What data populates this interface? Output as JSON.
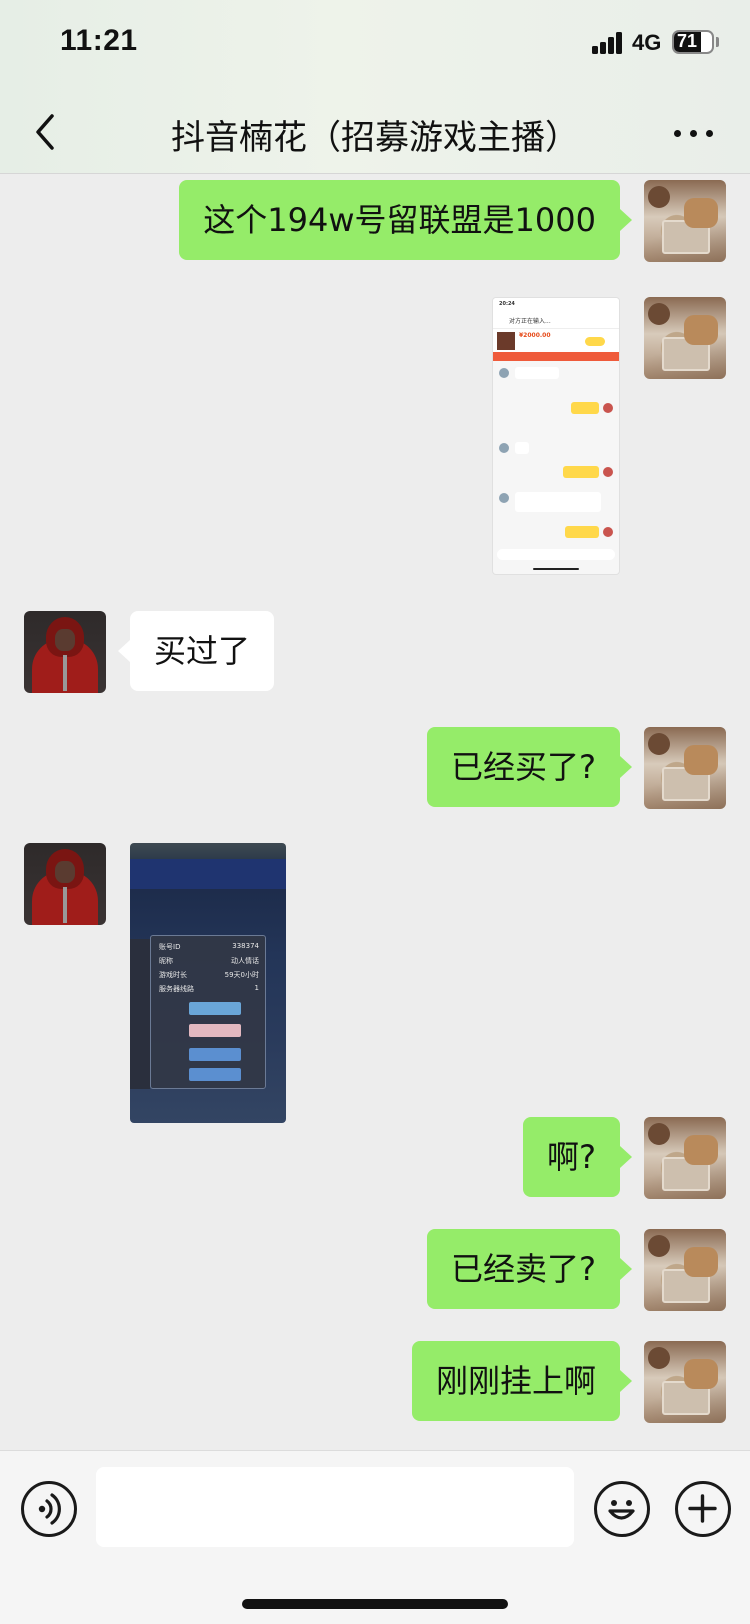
{
  "status_bar": {
    "time": "11:21",
    "network": "4G",
    "battery": "71",
    "battery_level": 0.71
  },
  "nav": {
    "title": "抖音楠花（招募游戏主播）",
    "back_icon": "chevron-left-icon",
    "more_icon": "more-dots-icon"
  },
  "messages": [
    {
      "side": "me",
      "type": "text",
      "text": "这个194w号留联盟是1000"
    },
    {
      "side": "me",
      "type": "image",
      "image": "chat-screenshot"
    },
    {
      "side": "other",
      "type": "text",
      "text": "买过了"
    },
    {
      "side": "me",
      "type": "text",
      "text": "已经买了?"
    },
    {
      "side": "other",
      "type": "image",
      "image": "game-screenshot"
    },
    {
      "side": "me",
      "type": "text",
      "text": "啊?"
    },
    {
      "side": "me",
      "type": "text",
      "text": "已经卖了?"
    },
    {
      "side": "me",
      "type": "text",
      "text": "刚刚挂上啊"
    }
  ],
  "chat_screenshot": {
    "time": "20:24",
    "title": "对方正在输入...",
    "price": "¥2000.00"
  },
  "game_screenshot": {
    "rows": [
      {
        "key": "账号ID",
        "value": "338374"
      },
      {
        "key": "昵称",
        "value": "动人情话"
      },
      {
        "key": "游戏时长",
        "value": "59天0小时"
      },
      {
        "key": "服务器线路",
        "value": "1"
      }
    ]
  },
  "input_bar": {
    "placeholder": "",
    "voice_icon": "voice-icon",
    "emoji_icon": "emoji-icon",
    "plus_icon": "plus-icon"
  },
  "colors": {
    "my_bubble": "#95ec69",
    "other_bubble": "#ffffff",
    "background": "#ededed"
  }
}
